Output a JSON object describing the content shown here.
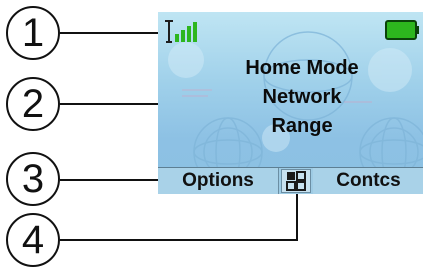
{
  "callouts": [
    "1",
    "2",
    "3",
    "4"
  ],
  "status": {
    "signal_icon": "signal-bars-icon",
    "battery_icon": "battery-icon"
  },
  "display": {
    "message_lines": [
      "Home Mode",
      "Network",
      "Range"
    ]
  },
  "softkeys": {
    "left": "Options",
    "center_icon": "menu-grid-icon",
    "right": "Contcs"
  },
  "colors": {
    "screen_bg": "#9fd0ea",
    "softkey_bg": "#a9d2e8",
    "battery": "#2db61e",
    "signal": "#2db61e"
  }
}
